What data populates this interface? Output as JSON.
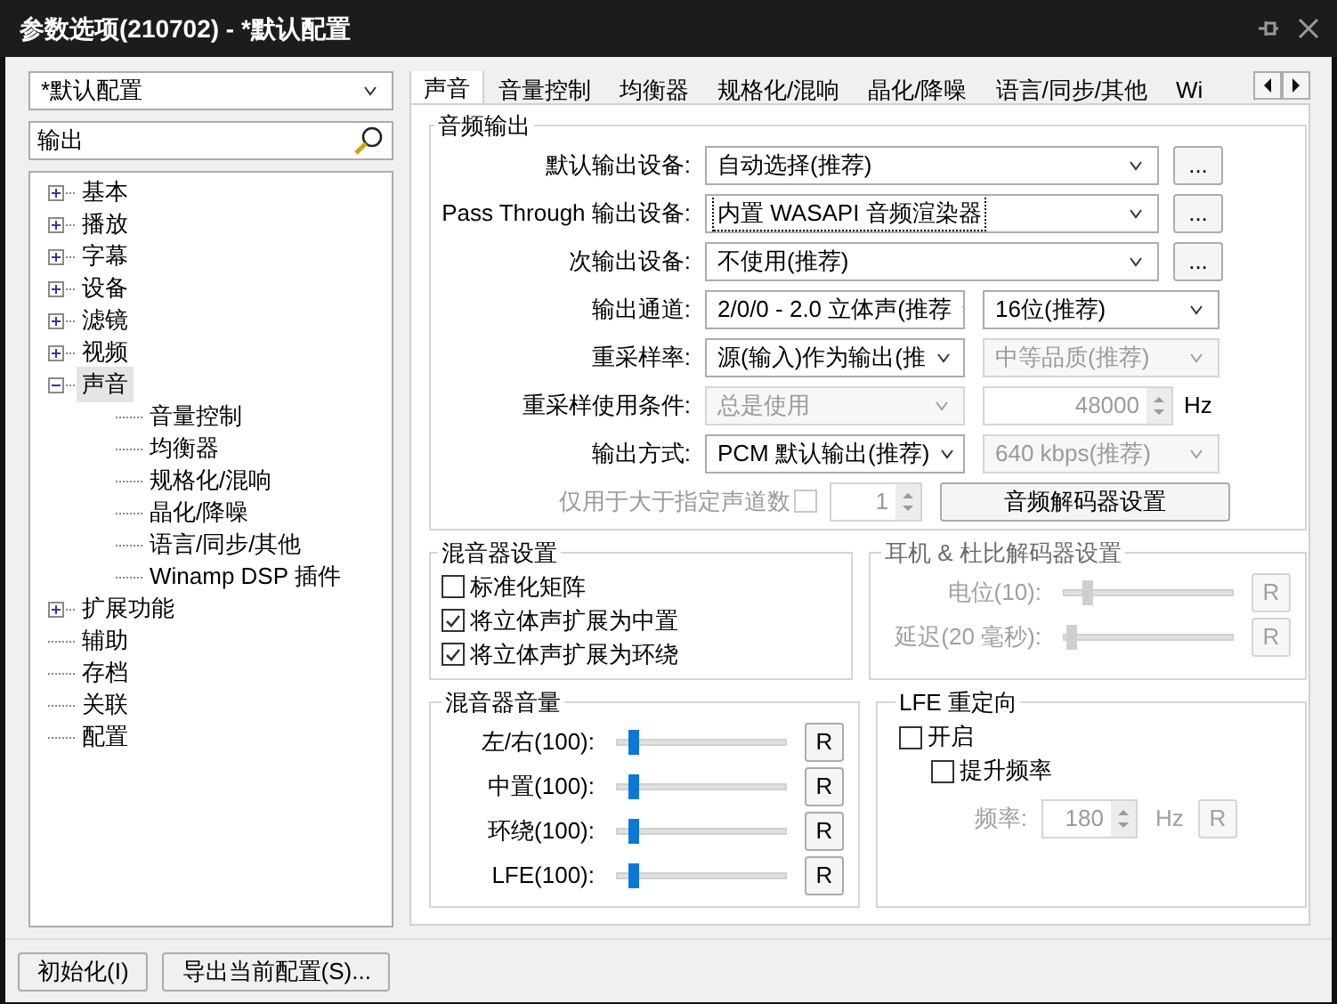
{
  "window": {
    "title": "参数选项(210702) - *默认配置"
  },
  "profile": {
    "value": "*默认配置"
  },
  "search": {
    "value": "输出"
  },
  "tree": [
    {
      "label": "基本",
      "expanded": false,
      "selected": false
    },
    {
      "label": "播放",
      "expanded": false,
      "selected": false
    },
    {
      "label": "字幕",
      "expanded": false,
      "selected": false
    },
    {
      "label": "设备",
      "expanded": false,
      "selected": false
    },
    {
      "label": "滤镜",
      "expanded": false,
      "selected": false
    },
    {
      "label": "视频",
      "expanded": false,
      "selected": false
    },
    {
      "label": "声音",
      "expanded": true,
      "selected": true,
      "children": [
        {
          "label": "音量控制",
          "selected": false
        },
        {
          "label": "均衡器",
          "selected": false
        },
        {
          "label": "规格化/混响",
          "selected": false
        },
        {
          "label": "晶化/降噪",
          "selected": false
        },
        {
          "label": "语言/同步/其他",
          "selected": false
        },
        {
          "label": "Winamp DSP 插件",
          "selected": false
        }
      ]
    },
    {
      "label": "扩展功能",
      "expanded": false,
      "selected": false
    },
    {
      "label": "辅助",
      "selected": false
    },
    {
      "label": "存档",
      "selected": false
    },
    {
      "label": "关联",
      "selected": false
    },
    {
      "label": "配置",
      "selected": false
    }
  ],
  "tabs": [
    {
      "label": "声音",
      "selected": true
    },
    {
      "label": "音量控制",
      "selected": false
    },
    {
      "label": "均衡器",
      "selected": false
    },
    {
      "label": "规格化/混响",
      "selected": false
    },
    {
      "label": "晶化/降噪",
      "selected": false
    },
    {
      "label": "语言/同步/其他",
      "selected": false
    },
    {
      "label": "Wi",
      "selected": false
    }
  ],
  "audio_output": {
    "title": "音频输出",
    "rows": [
      {
        "kind": "device",
        "label": "默认输出设备:",
        "value": "自动选择(推荐)",
        "focused": false,
        "button": "..."
      },
      {
        "kind": "device",
        "label": "Pass Through 输出设备:",
        "value": "内置 WASAPI 音频渲染器",
        "focused": true,
        "button": "..."
      },
      {
        "kind": "device",
        "label": "次输出设备:",
        "value": "不使用(推荐)",
        "focused": false,
        "button": "..."
      },
      {
        "kind": "pair",
        "label": "输出通道:",
        "left": {
          "value": "2/0/0 - 2.0 立体声(推荐",
          "disabled": false
        },
        "right": {
          "value": "16位(推荐)",
          "disabled": false
        }
      },
      {
        "kind": "pair",
        "label": "重采样率:",
        "left": {
          "value": "源(输入)作为输出(推",
          "disabled": false
        },
        "right": {
          "value": "中等品质(推荐)",
          "disabled": true
        }
      },
      {
        "kind": "spin",
        "label": "重采样使用条件:",
        "left": {
          "value": "总是使用",
          "disabled": true
        },
        "right": {
          "value": "48000",
          "disabled": true
        },
        "unit": "Hz"
      },
      {
        "kind": "pair",
        "label": "输出方式:",
        "left": {
          "value": "PCM 默认输出(推荐)",
          "disabled": false
        },
        "right": {
          "value": "640 kbps(推荐)",
          "disabled": true
        }
      }
    ],
    "channel_limit": {
      "label": "仅用于大于指定声道数",
      "checked": false,
      "disabled": true,
      "value": "1",
      "button": "音频解码器设置"
    }
  },
  "mixer_settings": {
    "title": "混音器设置",
    "options": [
      {
        "label": "标准化矩阵",
        "checked": false
      },
      {
        "label": "将立体声扩展为中置",
        "checked": true
      },
      {
        "label": "将立体声扩展为环绕",
        "checked": true
      }
    ]
  },
  "headphone": {
    "title": "耳机 & 杜比解码器设置",
    "disabled": true,
    "sliders": [
      {
        "label": "电位(10):",
        "level": 0.15,
        "button": "R"
      },
      {
        "label": "延迟(20 毫秒):",
        "level": 0.05,
        "button": "R"
      }
    ]
  },
  "mixer_volume": {
    "title": "混音器音量",
    "sliders": [
      {
        "label": "左/右(100):",
        "level": 0.1,
        "button": "R"
      },
      {
        "label": "中置(100):",
        "level": 0.1,
        "button": "R"
      },
      {
        "label": "环绕(100):",
        "level": 0.1,
        "button": "R"
      },
      {
        "label": "LFE(100):",
        "level": 0.1,
        "button": "R"
      }
    ]
  },
  "lfe": {
    "title": "LFE 重定向",
    "options": [
      {
        "label": "开启",
        "checked": false,
        "children": [
          {
            "label": "提升频率",
            "checked": false
          }
        ]
      }
    ],
    "frequency": {
      "label": "频率:",
      "value": "180",
      "unit": "Hz",
      "button": "R",
      "disabled": true
    }
  },
  "footer": {
    "buttons": [
      "初始化(I)",
      "导出当前配置(S)..."
    ]
  }
}
